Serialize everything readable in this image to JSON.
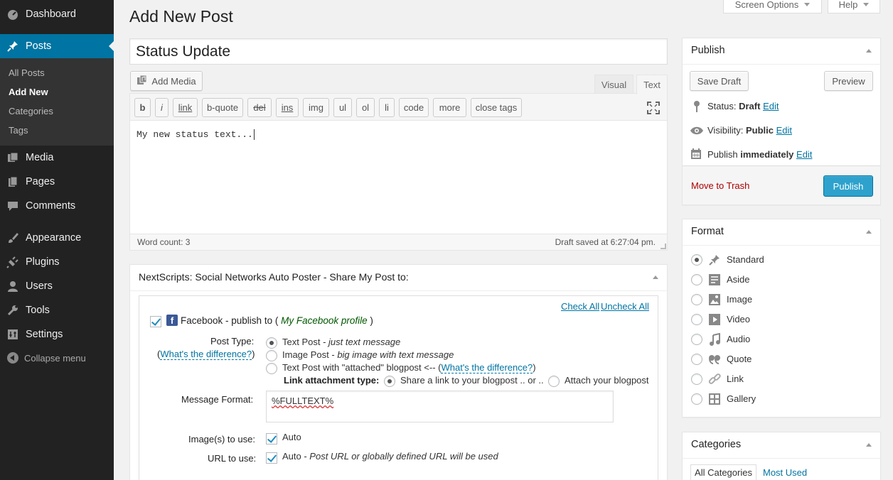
{
  "nav": {
    "dashboard": "Dashboard",
    "posts": "Posts",
    "posts_sub": [
      "All Posts",
      "Add New",
      "Categories",
      "Tags"
    ],
    "media": "Media",
    "pages": "Pages",
    "comments": "Comments",
    "appearance": "Appearance",
    "plugins": "Plugins",
    "users": "Users",
    "tools": "Tools",
    "settings": "Settings",
    "collapse": "Collapse menu"
  },
  "top": {
    "screen_options": "Screen Options",
    "help": "Help"
  },
  "page_title": "Add New Post",
  "post_title": "Status Update",
  "editor": {
    "add_media": "Add Media",
    "tab_visual": "Visual",
    "tab_text": "Text",
    "quicktags": [
      "b",
      "i",
      "link",
      "b-quote",
      "del",
      "ins",
      "img",
      "ul",
      "ol",
      "li",
      "code",
      "more",
      "close tags"
    ],
    "content": "My new status text...",
    "word_count": "Word count: 3",
    "draft_saved": "Draft saved at 6:27:04 pm."
  },
  "publish": {
    "heading": "Publish",
    "save_draft": "Save Draft",
    "preview": "Preview",
    "status_label": "Status:",
    "status_value": "Draft",
    "visibility_label": "Visibility:",
    "visibility_value": "Public",
    "publish_label": "Publish",
    "publish_value": "immediately",
    "edit": "Edit",
    "move_trash": "Move to Trash",
    "publish_button": "Publish"
  },
  "format": {
    "heading": "Format",
    "options": [
      "Standard",
      "Aside",
      "Image",
      "Video",
      "Audio",
      "Quote",
      "Link",
      "Gallery"
    ],
    "selected": "Standard"
  },
  "categories": {
    "heading": "Categories",
    "tab_all": "All Categories",
    "tab_most": "Most Used"
  },
  "snap": {
    "heading": "NextScripts: Social Networks Auto Poster - Share My Post to:",
    "check_all": "Check All",
    "uncheck_all": "Uncheck All",
    "fb_prefix": "Facebook - publish to (",
    "fb_profile": "My Facebook profile",
    "fb_suffix": ")",
    "post_type_label": "Post Type:",
    "whats_diff": "What's the difference?",
    "paren_open": "(",
    "paren_close": ")",
    "text_post": "Text Post - ",
    "text_post_desc": "just text message",
    "image_post": "Image Post - ",
    "image_post_desc": "big image with text message",
    "text_attached": "Text Post with \"attached\" blogpost <-- (",
    "text_attached_close": ")",
    "link_attach_label": "Link attachment type:",
    "share_link": "Share a link to your blogpost .. or ..",
    "attach_blog": "Attach your blogpost",
    "message_format_label": "Message Format:",
    "message_format_value": "%FULLTEXT%",
    "images_label": "Image(s) to use:",
    "images_value": "Auto",
    "url_label": "URL to use:",
    "url_value": "Auto - ",
    "url_desc": "Post URL or globally defined URL will be used"
  },
  "colors": {
    "sidebar": "#222222",
    "active": "#0074a2",
    "publish_btn": "#2ea2cc",
    "trash": "#a00000"
  }
}
